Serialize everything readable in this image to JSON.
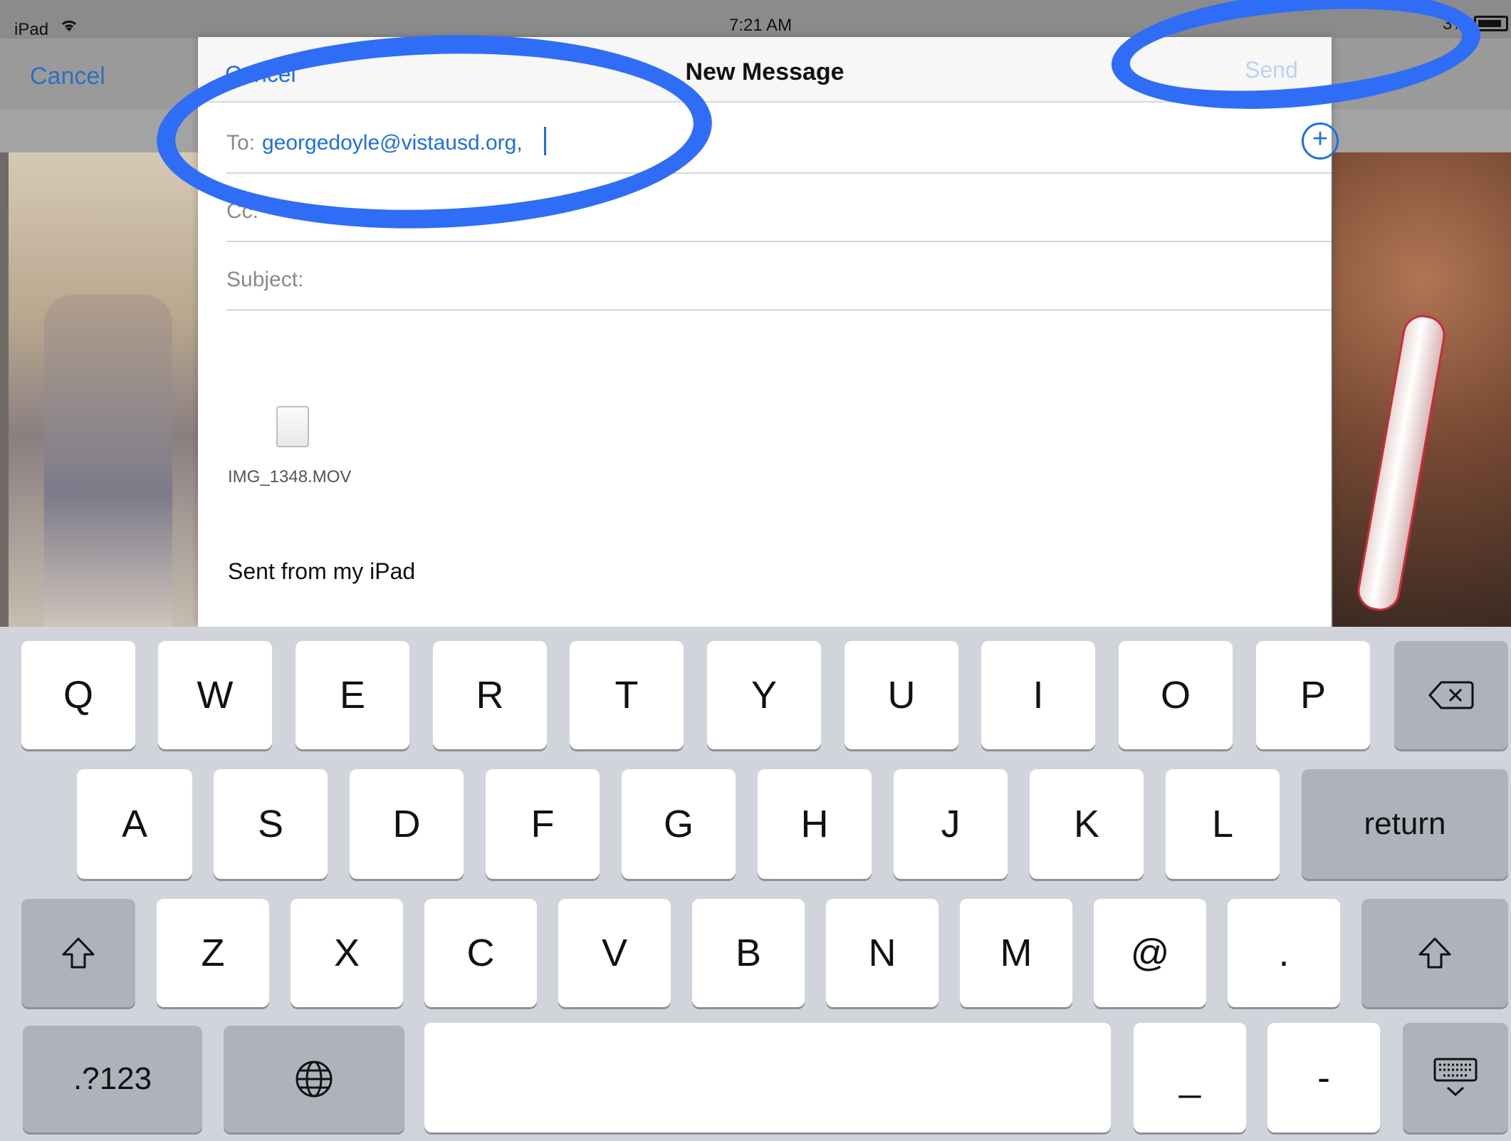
{
  "status_bar": {
    "device": "iPad",
    "wifi_icon": "wifi-icon",
    "time": "7:21 AM",
    "battery_text": "3%"
  },
  "background_app": {
    "cancel_label": "Cancel"
  },
  "compose": {
    "cancel_label": "Cancel",
    "title": "New Message",
    "send_label": "Send",
    "to_label": "To:",
    "to_value": "georgedoyle@vistausd.org,",
    "cc_label": "Cc:",
    "subject_label": "Subject:",
    "attachment_name": "IMG_1348.MOV",
    "signature": "Sent from my iPad"
  },
  "annotation_color": "#2f6df6",
  "keyboard": {
    "row1": [
      "Q",
      "W",
      "E",
      "R",
      "T",
      "Y",
      "U",
      "I",
      "O",
      "P"
    ],
    "row2": [
      "A",
      "S",
      "D",
      "F",
      "G",
      "H",
      "J",
      "K",
      "L"
    ],
    "row3": [
      "Z",
      "X",
      "C",
      "V",
      "B",
      "N",
      "M",
      "@",
      "."
    ],
    "return_label": "return",
    "numbers_label": ".?123",
    "underscore_label": "_",
    "hyphen_label": "-",
    "icons": {
      "delete": "delete-icon",
      "shift": "shift-icon",
      "globe": "globe-icon",
      "dismiss": "keyboard-dismiss-icon"
    }
  }
}
